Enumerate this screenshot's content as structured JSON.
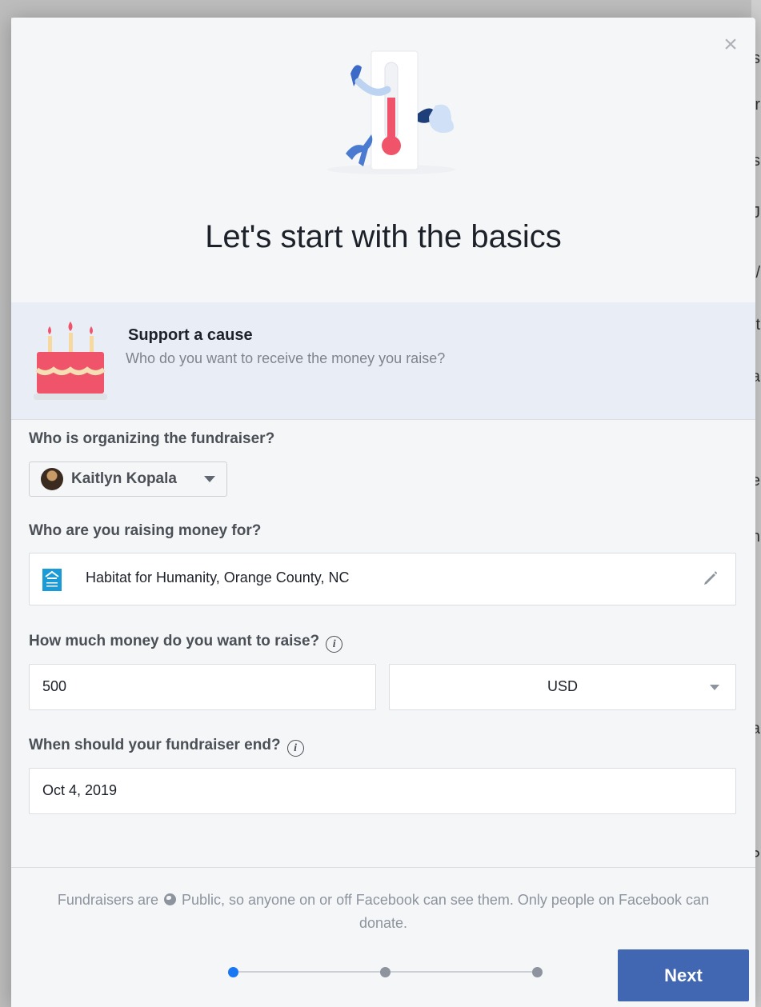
{
  "background": {
    "side_letters": [
      "s",
      "r",
      "s",
      "J",
      "/",
      "t",
      "a",
      "e",
      "h",
      "a",
      "P"
    ]
  },
  "modal": {
    "close_glyph": "×",
    "title": "Let's start with the basics",
    "cause": {
      "title": "Support a cause",
      "subtitle": "Who do you want to receive the money you raise?"
    },
    "organizer": {
      "label": "Who is organizing the fundraiser?",
      "name": "Kaitlyn Kopala"
    },
    "beneficiary": {
      "label": "Who are you raising money for?",
      "value": "Habitat for Humanity, Orange County, NC"
    },
    "goal": {
      "label": "How much money do you want to raise?",
      "amount": "500",
      "currency": "USD"
    },
    "end_date": {
      "label": "When should your fundraiser end?",
      "value": "Oct 4, 2019"
    },
    "info_glyph": "i",
    "footer": {
      "privacy_before": "Fundraisers are",
      "privacy_after": "Public, so anyone on or off Facebook can see them. Only people on Facebook can donate.",
      "steps_total": 3,
      "current_step": 1,
      "next_label": "Next"
    }
  },
  "colors": {
    "primary_button": "#4267b2",
    "active_step": "#1877f2",
    "banner": "#e9eef6"
  }
}
